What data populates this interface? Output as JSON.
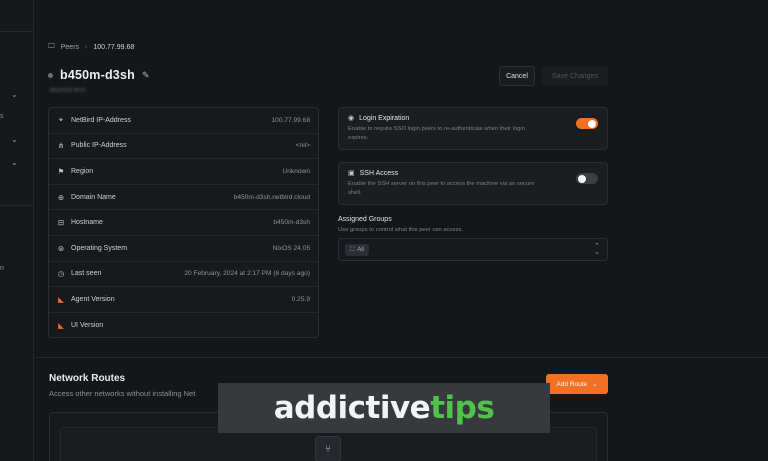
{
  "sidebar": {
    "fragments": [
      "s",
      "n"
    ]
  },
  "breadcrumb": {
    "icon": "monitor-icon",
    "parent": "Peers",
    "separator": "›",
    "current": "100.77.99.68"
  },
  "peer": {
    "name": "b450m-d3sh",
    "subtitle": "blurred text",
    "status_color": "#6b6f76"
  },
  "actions": {
    "cancel": "Cancel",
    "save": "Save Changes"
  },
  "info_rows": [
    {
      "icon": "pin-icon",
      "label": "NetBird IP-Address",
      "value": "100.77.99.68"
    },
    {
      "icon": "network-icon",
      "label": "Public IP-Address",
      "value": "<nil>"
    },
    {
      "icon": "flag-icon",
      "label": "Region",
      "value": "Unknown"
    },
    {
      "icon": "globe-icon",
      "label": "Domain Name",
      "value": "b450m-d3sh.netbird.cloud"
    },
    {
      "icon": "server-icon",
      "label": "Hostname",
      "value": "b450m-d3sh"
    },
    {
      "icon": "os-icon",
      "label": "Operating System",
      "value": "NixOS 24.05"
    },
    {
      "icon": "clock-icon",
      "label": "Last seen",
      "value": "20 February, 2024 at 2:17 PM (8 days ago)"
    },
    {
      "icon": "netbird-icon",
      "label": "Agent Version",
      "value": "0.25.9"
    },
    {
      "icon": "netbird-icon",
      "label": "UI Version",
      "value": ""
    }
  ],
  "login_expiration": {
    "title": "Login Expiration",
    "description": "Enable to require SSO login peers to re-authenticate when their login expires.",
    "enabled": true
  },
  "ssh_access": {
    "title": "SSH Access",
    "description": "Enable the SSH server on this peer to access the machine via an secure shell.",
    "enabled": false
  },
  "assigned_groups": {
    "title": "Assigned Groups",
    "description": "Use groups to control what this peer can access.",
    "chips": [
      "All"
    ]
  },
  "network_routes": {
    "title": "Network Routes",
    "description": "Access other networks without installing Net",
    "add_button": "Add Route"
  },
  "watermark": {
    "part1": "addictive",
    "part2": "tips",
    "color_main": "#f2f3f4",
    "color_accent": "#4fc24a"
  },
  "colors": {
    "accent": "#f27024",
    "background": "#141619"
  }
}
